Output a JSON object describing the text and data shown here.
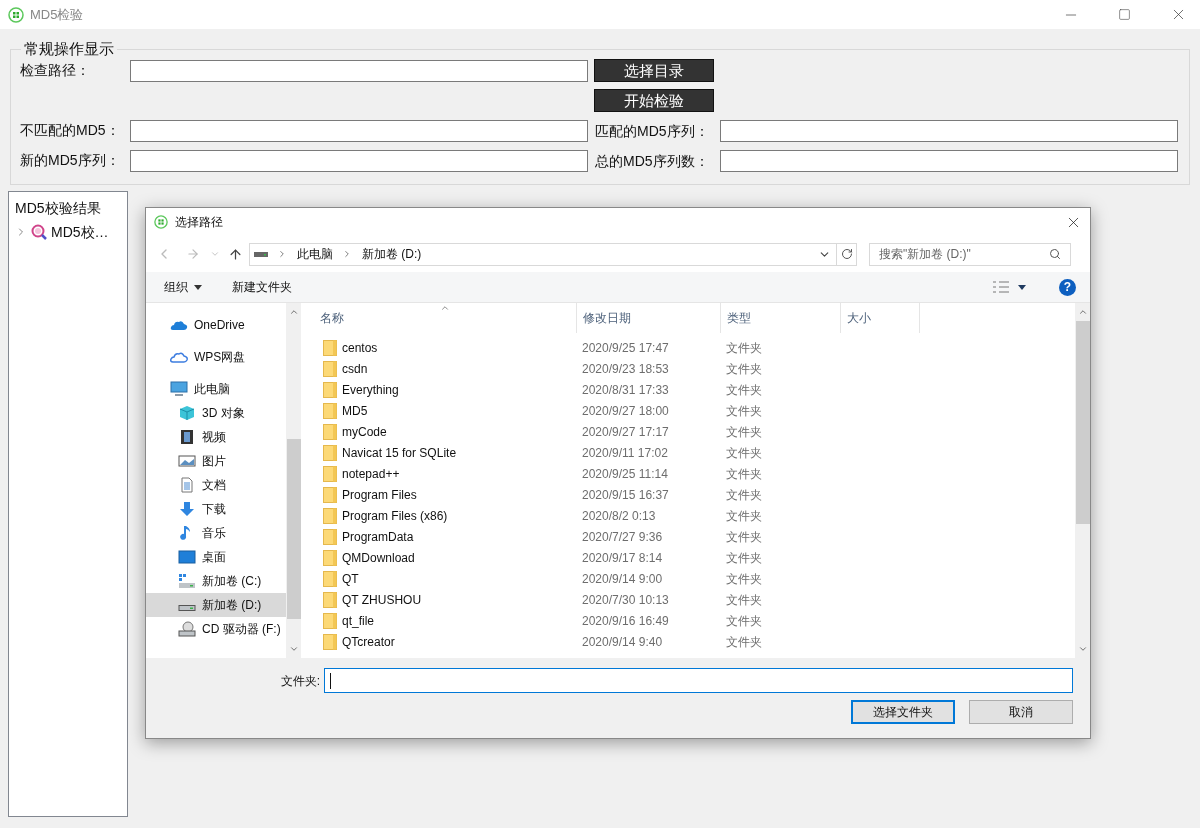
{
  "window": {
    "title": "MD5检验"
  },
  "group": {
    "title": "常规操作显示",
    "path_label": "检查路径：",
    "buttons": [
      "选择目录",
      "开始检验"
    ],
    "fields": [
      {
        "label": "不匹配的MD5："
      },
      {
        "label": "匹配的MD5序列："
      },
      {
        "label": "新的MD5序列："
      },
      {
        "label": "总的MD5序列数："
      }
    ]
  },
  "tree": {
    "header": "MD5校验结果",
    "items": [
      {
        "label": "MD5校…",
        "expanded": false
      }
    ]
  },
  "dialog": {
    "title": "选择路径",
    "breadcrumb": [
      "此电脑",
      "新加卷 (D:)"
    ],
    "search": {
      "placeholder": "搜索\"新加卷 (D:)\""
    },
    "toolbar": [
      {
        "label": "组织",
        "kind": "menu"
      },
      {
        "label": "新建文件夹",
        "kind": "plain"
      }
    ],
    "nav": [
      {
        "label": "OneDrive",
        "kind": "cloud",
        "selected": false
      },
      {
        "label": "WPS网盘",
        "kind": "cloud-outline",
        "selected": false
      },
      {
        "label": "此电脑",
        "kind": "computer",
        "selected": false,
        "children": [
          {
            "label": "3D 对象",
            "kind": "cube",
            "selected": false
          },
          {
            "label": "视频",
            "kind": "video",
            "selected": false
          },
          {
            "label": "图片",
            "kind": "image",
            "selected": false
          },
          {
            "label": "文档",
            "kind": "document",
            "selected": false
          },
          {
            "label": "下载",
            "kind": "download",
            "selected": false
          },
          {
            "label": "音乐",
            "kind": "music",
            "selected": false
          },
          {
            "label": "桌面",
            "kind": "desktop",
            "selected": false
          },
          {
            "label": "新加卷 (C:)",
            "kind": "drive-windows",
            "selected": false
          },
          {
            "label": "新加卷 (D:)",
            "kind": "drive",
            "selected": true
          },
          {
            "label": "CD 驱动器 (F:)",
            "kind": "cd",
            "selected": false
          }
        ]
      }
    ],
    "help": "?",
    "columns": [
      "名称",
      "修改日期",
      "类型",
      "大小"
    ],
    "rows": [
      {
        "name": "centos",
        "date": "2020/9/25 17:47",
        "type": "文件夹"
      },
      {
        "name": "csdn",
        "date": "2020/9/23 18:53",
        "type": "文件夹"
      },
      {
        "name": "Everything",
        "date": "2020/8/31 17:33",
        "type": "文件夹"
      },
      {
        "name": "MD5",
        "date": "2020/9/27 18:00",
        "type": "文件夹"
      },
      {
        "name": "myCode",
        "date": "2020/9/27 17:17",
        "type": "文件夹"
      },
      {
        "name": "Navicat 15 for SQLite",
        "date": "2020/9/11 17:02",
        "type": "文件夹"
      },
      {
        "name": "notepad++",
        "date": "2020/9/25 11:14",
        "type": "文件夹"
      },
      {
        "name": "Program Files",
        "date": "2020/9/15 16:37",
        "type": "文件夹"
      },
      {
        "name": "Program Files (x86)",
        "date": "2020/8/2 0:13",
        "type": "文件夹"
      },
      {
        "name": "ProgramData",
        "date": "2020/7/27 9:36",
        "type": "文件夹"
      },
      {
        "name": "QMDownload",
        "date": "2020/9/17 8:14",
        "type": "文件夹"
      },
      {
        "name": "QT",
        "date": "2020/9/14 9:00",
        "type": "文件夹"
      },
      {
        "name": "QT ZHUSHOU",
        "date": "2020/7/30 10:13",
        "type": "文件夹"
      },
      {
        "name": "qt_file",
        "date": "2020/9/16 16:49",
        "type": "文件夹"
      },
      {
        "name": "QTcreator",
        "date": "2020/9/14 9:40",
        "type": "文件夹"
      }
    ],
    "folder_label": "文件夹:",
    "buttons": [
      {
        "label": "选择文件夹",
        "kind": "primary"
      },
      {
        "label": "取消",
        "kind": "secondary"
      }
    ]
  }
}
